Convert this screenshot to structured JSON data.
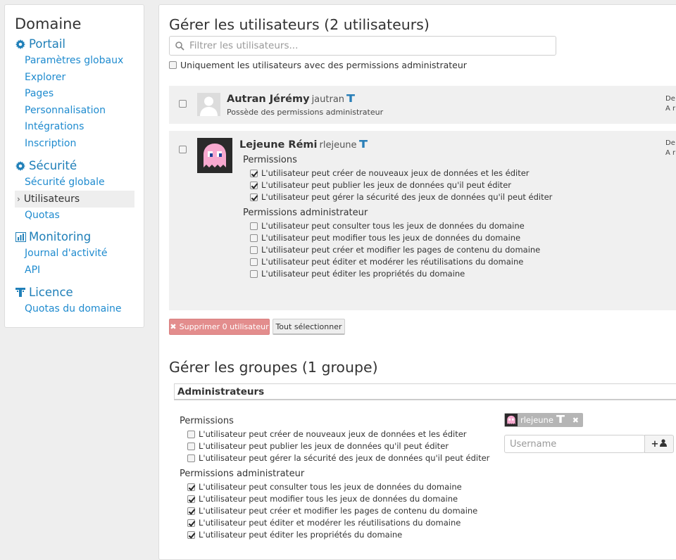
{
  "sidebar": {
    "title": "Domaine",
    "sections": [
      {
        "label": "Portail",
        "icon": "gear-icon"
      },
      {
        "label": "Sécurité",
        "icon": "gear-icon"
      },
      {
        "label": "Monitoring",
        "icon": "bar-chart-icon"
      },
      {
        "label": "Licence",
        "icon": "license-icon"
      }
    ],
    "portail_items": [
      "Paramètres globaux",
      "Explorer",
      "Pages",
      "Personnalisation",
      "Intégrations",
      "Inscription"
    ],
    "securite_items": [
      "Sécurité globale",
      "Utilisateurs",
      "Quotas"
    ],
    "monitoring_items": [
      "Journal d'activité",
      "API"
    ],
    "licence_items": [
      "Quotas du domaine"
    ]
  },
  "users": {
    "heading": "Gérer les utilisateurs (2 utilisateurs)",
    "filter_placeholder": "Filtrer les utilisateurs...",
    "admin_only_label": "Uniquement les utilisateurs avec des permissions administrateur",
    "list": [
      {
        "name": "Autran Jérémy",
        "login": "jautran",
        "description": "Possède des permissions administrateur",
        "right_line1": "De",
        "right_line2": "A r"
      },
      {
        "name": "Lejeune Rémi",
        "login": "rlejeune",
        "right_line1": "De",
        "right_line2": "A r",
        "permissions_title": "Permissions",
        "permissions": [
          {
            "label": "L'utilisateur peut créer de nouveaux jeux de données et les éditer",
            "checked": true
          },
          {
            "label": "L'utilisateur peut publier les jeux de données qu'il peut éditer",
            "checked": true
          },
          {
            "label": "L'utilisateur peut gérer la sécurité des jeux de données qu'il peut éditer",
            "checked": true
          }
        ],
        "admin_permissions_title": "Permissions administrateur",
        "admin_permissions": [
          {
            "label": "L'utilisateur peut consulter tous les jeux de données du domaine",
            "checked": false
          },
          {
            "label": "L'utilisateur peut modifier tous les jeux de données du domaine",
            "checked": false
          },
          {
            "label": "L'utilisateur peut créer et modifier les pages de contenu du domaine",
            "checked": false
          },
          {
            "label": "L'utilisateur peut éditer et modérer les réutilisations du domaine",
            "checked": false
          },
          {
            "label": "L'utilisateur peut éditer les propriétés du domaine",
            "checked": false
          }
        ]
      }
    ],
    "delete_button": "Supprimer 0 utilisateur",
    "select_all_button": "Tout sélectionner"
  },
  "groups": {
    "heading": "Gérer les groupes (1 groupe)",
    "group_name": "Administrateurs",
    "permissions_title": "Permissions",
    "permissions": [
      {
        "label": "L'utilisateur peut créer de nouveaux jeux de données et les éditer",
        "checked": false
      },
      {
        "label": "L'utilisateur peut publier les jeux de données qu'il peut éditer",
        "checked": false
      },
      {
        "label": "L'utilisateur peut gérer la sécurité des jeux de données qu'il peut éditer",
        "checked": false
      }
    ],
    "admin_permissions_title": "Permissions administrateur",
    "admin_permissions": [
      {
        "label": "L'utilisateur peut consulter tous les jeux de données du domaine",
        "checked": true
      },
      {
        "label": "L'utilisateur peut modifier tous les jeux de données du domaine",
        "checked": true
      },
      {
        "label": "L'utilisateur peut créer et modifier les pages de contenu du domaine",
        "checked": true
      },
      {
        "label": "L'utilisateur peut éditer et modérer les réutilisations du domaine",
        "checked": true
      },
      {
        "label": "L'utilisateur peut éditer les propriétés du domaine",
        "checked": true
      }
    ],
    "member_login": "rlejeune",
    "username_placeholder": "Username"
  },
  "colors": {
    "link": "#1f8bcf",
    "danger": "#e38d8d",
    "card_bg": "#f0f0f0"
  }
}
